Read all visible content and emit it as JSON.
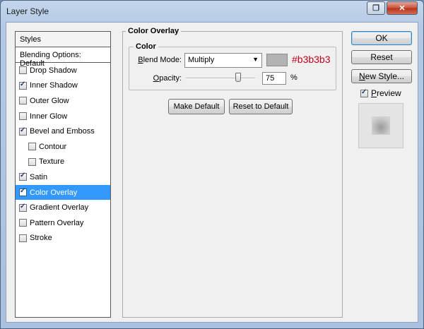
{
  "window": {
    "title": "Layer Style"
  },
  "styles_panel": {
    "header": "Styles",
    "blending_options": "Blending Options: Default",
    "items": [
      {
        "label": "Drop Shadow",
        "checked": false,
        "selected": false,
        "indent": false
      },
      {
        "label": "Inner Shadow",
        "checked": true,
        "selected": false,
        "indent": false
      },
      {
        "label": "Outer Glow",
        "checked": false,
        "selected": false,
        "indent": false
      },
      {
        "label": "Inner Glow",
        "checked": false,
        "selected": false,
        "indent": false
      },
      {
        "label": "Bevel and Emboss",
        "checked": true,
        "selected": false,
        "indent": false
      },
      {
        "label": "Contour",
        "checked": false,
        "selected": false,
        "indent": true
      },
      {
        "label": "Texture",
        "checked": false,
        "selected": false,
        "indent": true
      },
      {
        "label": "Satin",
        "checked": true,
        "selected": false,
        "indent": false
      },
      {
        "label": "Color Overlay",
        "checked": true,
        "selected": true,
        "indent": false
      },
      {
        "label": "Gradient Overlay",
        "checked": true,
        "selected": false,
        "indent": false
      },
      {
        "label": "Pattern Overlay",
        "checked": false,
        "selected": false,
        "indent": false
      },
      {
        "label": "Stroke",
        "checked": false,
        "selected": false,
        "indent": false
      }
    ]
  },
  "color_overlay": {
    "group_title": "Color Overlay",
    "color_group_title": "Color",
    "blend_mode_label_key": "B",
    "blend_mode_label_rest": "lend Mode:",
    "blend_mode_value": "Multiply",
    "swatch_color": "#b3b3b3",
    "swatch_annotation": "#b3b3b3",
    "opacity_label_key": "O",
    "opacity_label_rest": "pacity:",
    "opacity_value": "75",
    "opacity_unit": "%",
    "opacity_fraction": 0.75,
    "make_default_label": "Make Default",
    "reset_default_label": "Reset to Default"
  },
  "actions": {
    "ok_label": "OK",
    "reset_label": "Reset",
    "new_style_key": "N",
    "new_style_rest": "ew Style...",
    "preview_label_key": "P",
    "preview_label_rest": "review",
    "preview_checked": true
  },
  "colors": {
    "accent_selected": "#3399ff",
    "annotation_red": "#c2001a"
  }
}
